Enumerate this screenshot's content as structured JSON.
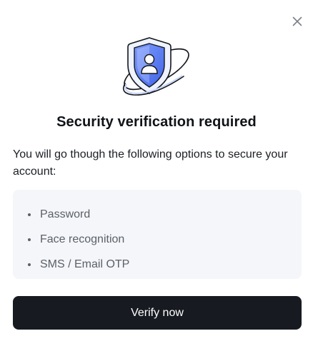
{
  "dialog": {
    "close_icon": "close-icon",
    "hero_icon": "shield-user-icon",
    "title": "Security verification required",
    "description": "You will go though the following options to secure your account:",
    "options": [
      {
        "label": "Password"
      },
      {
        "label": "Face recognition"
      },
      {
        "label": "SMS / Email OTP"
      }
    ],
    "verify_label": "Verify now"
  },
  "colors": {
    "button_bg": "#171a21",
    "options_bg": "#f5f6fa",
    "shield_accent": "#6c8cff"
  }
}
